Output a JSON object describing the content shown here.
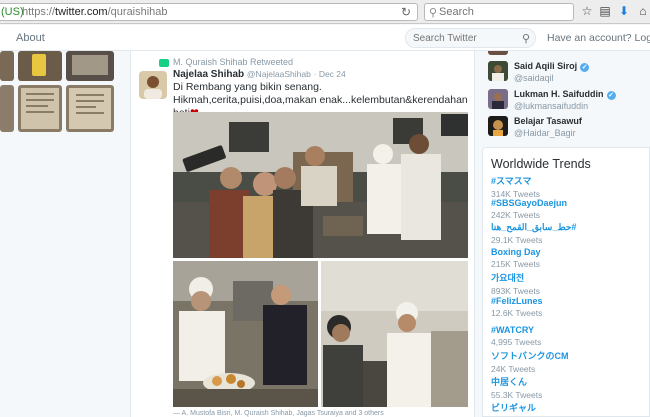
{
  "browser": {
    "url_secure_label": "(US)",
    "url_prefix": "https://",
    "url_host": "twitter.com",
    "url_path": "/quraishihab",
    "search_placeholder": "Search"
  },
  "header": {
    "about_label": "About",
    "search_placeholder": "Search Twitter",
    "login_label": "Have an account? Log in ▾"
  },
  "tweet": {
    "retweet_by": "M. Quraish Shihab Retweeted",
    "author_name": "Najelaa Shihab",
    "author_handle": "@NajelaaShihab",
    "date": "· Dec 24",
    "text": "Di Rembang yang bikin senang. Hikmah,cerita,puisi,doa,makan enak...kelembutan&kerendahan hati",
    "heart": "❤",
    "media_caption": "— A. Mustofa Bisri, M. Quraish Shihab, Jagas Tsuraiya and 3 others"
  },
  "who_to_follow": [
    {
      "name": "Said Aqili Siroj",
      "handle": "@saidaqil",
      "verified": true
    },
    {
      "name": "Lukman H. Saifuddin",
      "handle": "@lukmansaifuddin",
      "verified": true
    },
    {
      "name": "Belajar Tasawuf",
      "handle": "@Haidar_Bagir",
      "verified": false
    }
  ],
  "trends": {
    "title": "Worldwide Trends",
    "items": [
      {
        "name": "#スマスマ",
        "count": "314K Tweets"
      },
      {
        "name": "#SBSGayoDaejun",
        "count": "242K Tweets"
      },
      {
        "name": "#حط_سابق_القمح_هنا",
        "count": "29.1K Tweets"
      },
      {
        "name": "Boxing Day",
        "count": "215K Tweets"
      },
      {
        "name": "가요대전",
        "count": "893K Tweets"
      },
      {
        "name": "#FelizLunes",
        "count": "12.6K Tweets"
      },
      {
        "name": "#WATCRY",
        "count": "4,995 Tweets"
      },
      {
        "name": "ソフトバンクのCM",
        "count": "24K Tweets"
      },
      {
        "name": "中居くん",
        "count": "55.3K Tweets"
      },
      {
        "name": "ビリギャル",
        "count": ""
      }
    ]
  },
  "colors": {
    "accent": "#1b95e0",
    "retweet": "#19cf86",
    "verified": "#55acee"
  }
}
